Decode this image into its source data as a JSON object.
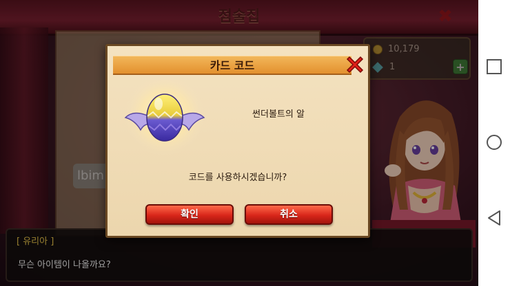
{
  "game": {
    "screen_title": "점술집",
    "currency": {
      "coins": "10,179",
      "gems": "1"
    },
    "background_input": "lbim",
    "dialogue": {
      "speaker": "[ 유리아 ]",
      "text": "무슨 아이템이 나올까요?"
    }
  },
  "modal": {
    "title": "카드 코드",
    "item_name": "썬더볼트의 알",
    "question": "코드를 사용하시겠습니까?",
    "confirm_label": "확인",
    "cancel_label": "취소"
  },
  "colors": {
    "accent": "#e3902e",
    "button_red": "#d8261a",
    "parchment": "#f4e2c0"
  },
  "icons": {
    "close": "close-x-icon",
    "coin": "coin-icon",
    "gem": "gem-icon",
    "plus": "plus-icon",
    "nav_recent": "recent-apps-icon",
    "nav_home": "home-icon",
    "nav_back": "back-icon"
  }
}
